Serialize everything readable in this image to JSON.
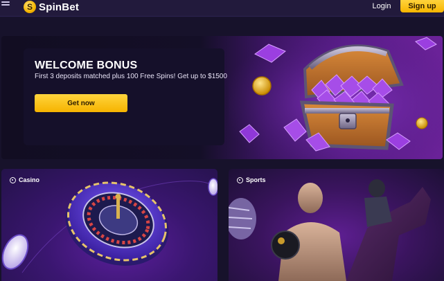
{
  "header": {
    "brand": "SpinBet",
    "logo_letter": "S",
    "login_label": "Login",
    "signup_label": "Sign up"
  },
  "hero": {
    "title": "WELCOME BONUS",
    "subtitle": "First 3 deposits matched plus 100 Free Spins! Get up to $1500",
    "cta_label": "Get now"
  },
  "cards": [
    {
      "label": "Casino",
      "icon": "chip-icon"
    },
    {
      "label": "Sports",
      "icon": "ball-icon"
    }
  ],
  "colors": {
    "accent": "#f7b500",
    "background": "#17122b",
    "purple": "#5a1d8a"
  }
}
